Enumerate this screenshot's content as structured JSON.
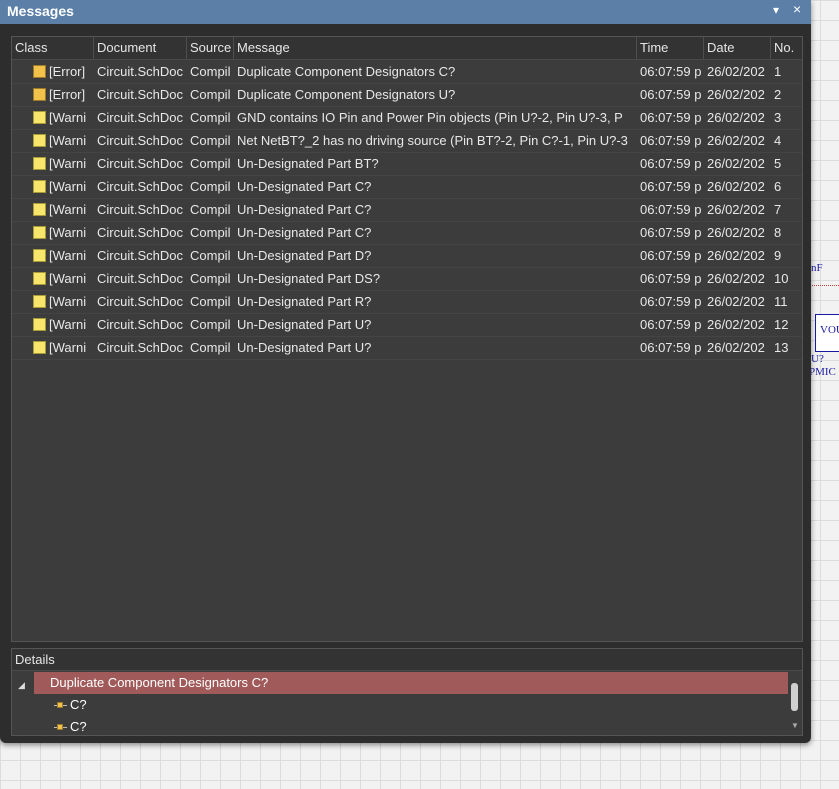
{
  "panel": {
    "title": "Messages",
    "menu_icon": "▾",
    "close_icon": "×"
  },
  "columns": {
    "class": "Class",
    "document": "Document",
    "source": "Source",
    "message": "Message",
    "time": "Time",
    "date": "Date",
    "no": "No."
  },
  "rows": [
    {
      "kind": "error",
      "class": "[Error]",
      "document": "Circuit.SchDoc",
      "source": "Compil",
      "message": "Duplicate Component Designators C?",
      "time": "06:07:59 p",
      "date": "26/02/202",
      "no": "1"
    },
    {
      "kind": "error",
      "class": "[Error]",
      "document": "Circuit.SchDoc",
      "source": "Compil",
      "message": "Duplicate Component Designators U?",
      "time": "06:07:59 p",
      "date": "26/02/202",
      "no": "2"
    },
    {
      "kind": "warn",
      "class": "[Warni",
      "document": "Circuit.SchDoc",
      "source": "Compil",
      "message": "GND contains IO Pin and Power Pin objects (Pin U?-2, Pin U?-3, P",
      "time": "06:07:59 p",
      "date": "26/02/202",
      "no": "3"
    },
    {
      "kind": "warn",
      "class": "[Warni",
      "document": "Circuit.SchDoc",
      "source": "Compil",
      "message": "Net NetBT?_2 has no driving source (Pin BT?-2, Pin C?-1, Pin U?-3",
      "time": "06:07:59 p",
      "date": "26/02/202",
      "no": "4"
    },
    {
      "kind": "warn",
      "class": "[Warni",
      "document": "Circuit.SchDoc",
      "source": "Compil",
      "message": "Un-Designated Part BT?",
      "time": "06:07:59 p",
      "date": "26/02/202",
      "no": "5"
    },
    {
      "kind": "warn",
      "class": "[Warni",
      "document": "Circuit.SchDoc",
      "source": "Compil",
      "message": "Un-Designated Part C?",
      "time": "06:07:59 p",
      "date": "26/02/202",
      "no": "6"
    },
    {
      "kind": "warn",
      "class": "[Warni",
      "document": "Circuit.SchDoc",
      "source": "Compil",
      "message": "Un-Designated Part C?",
      "time": "06:07:59 p",
      "date": "26/02/202",
      "no": "7"
    },
    {
      "kind": "warn",
      "class": "[Warni",
      "document": "Circuit.SchDoc",
      "source": "Compil",
      "message": "Un-Designated Part C?",
      "time": "06:07:59 p",
      "date": "26/02/202",
      "no": "8"
    },
    {
      "kind": "warn",
      "class": "[Warni",
      "document": "Circuit.SchDoc",
      "source": "Compil",
      "message": "Un-Designated Part D?",
      "time": "06:07:59 p",
      "date": "26/02/202",
      "no": "9"
    },
    {
      "kind": "warn",
      "class": "[Warni",
      "document": "Circuit.SchDoc",
      "source": "Compil",
      "message": "Un-Designated Part DS?",
      "time": "06:07:59 p",
      "date": "26/02/202",
      "no": "10"
    },
    {
      "kind": "warn",
      "class": "[Warni",
      "document": "Circuit.SchDoc",
      "source": "Compil",
      "message": "Un-Designated Part R?",
      "time": "06:07:59 p",
      "date": "26/02/202",
      "no": "11"
    },
    {
      "kind": "warn",
      "class": "[Warni",
      "document": "Circuit.SchDoc",
      "source": "Compil",
      "message": "Un-Designated Part U?",
      "time": "06:07:59 p",
      "date": "26/02/202",
      "no": "12"
    },
    {
      "kind": "warn",
      "class": "[Warni",
      "document": "Circuit.SchDoc",
      "source": "Compil",
      "message": "Un-Designated Part U?",
      "time": "06:07:59 p",
      "date": "26/02/202",
      "no": "13"
    }
  ],
  "details": {
    "header": "Details",
    "selected": "Duplicate Component Designators C?",
    "children": [
      "C?",
      "C?"
    ]
  },
  "schematic": {
    "label_mf": "nF",
    "label_vo": "VOU",
    "label_u": "U?",
    "label_pmic": "PMIC"
  },
  "colors": {
    "titlebar": "#5b7fa6",
    "selected_row": "#a05a5a",
    "error_icon": "#f3c24b",
    "warning_icon": "#f7e66b"
  }
}
